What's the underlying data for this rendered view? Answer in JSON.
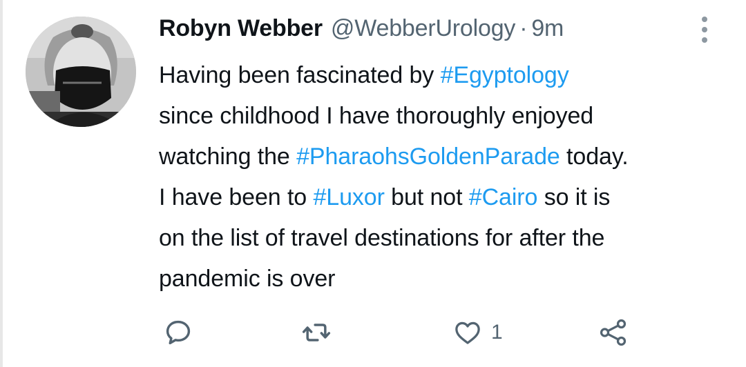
{
  "author": {
    "name": "Robyn Webber",
    "handle": "@WebberUrology",
    "separator": "·",
    "time": "9m"
  },
  "tweet": {
    "lines": [
      [
        {
          "t": "Having been fascinated by "
        },
        {
          "t": "#Egyptology",
          "tag": true
        }
      ],
      [
        {
          "t": "since childhood I have thoroughly enjoyed"
        }
      ],
      [
        {
          "t": "watching the "
        },
        {
          "t": "#PharaohsGoldenParade",
          "tag": true
        },
        {
          "t": " today."
        }
      ],
      [
        {
          "t": "I have been to "
        },
        {
          "t": "#Luxor",
          "tag": true
        },
        {
          "t": " but not "
        },
        {
          "t": "#Cairo",
          "tag": true
        },
        {
          "t": " so it is"
        }
      ],
      [
        {
          "t": "on the list of travel destinations for after the"
        }
      ],
      [
        {
          "t": "pandemic is over"
        }
      ]
    ]
  },
  "actions": {
    "reply": {
      "icon": "reply-icon"
    },
    "retweet": {
      "icon": "retweet-icon"
    },
    "like": {
      "icon": "heart-icon",
      "count": "1"
    },
    "share": {
      "icon": "share-icon"
    }
  },
  "colors": {
    "hashtag": "#1d9bf0",
    "secondary_text": "#536471",
    "primary_text": "#0f1419"
  }
}
